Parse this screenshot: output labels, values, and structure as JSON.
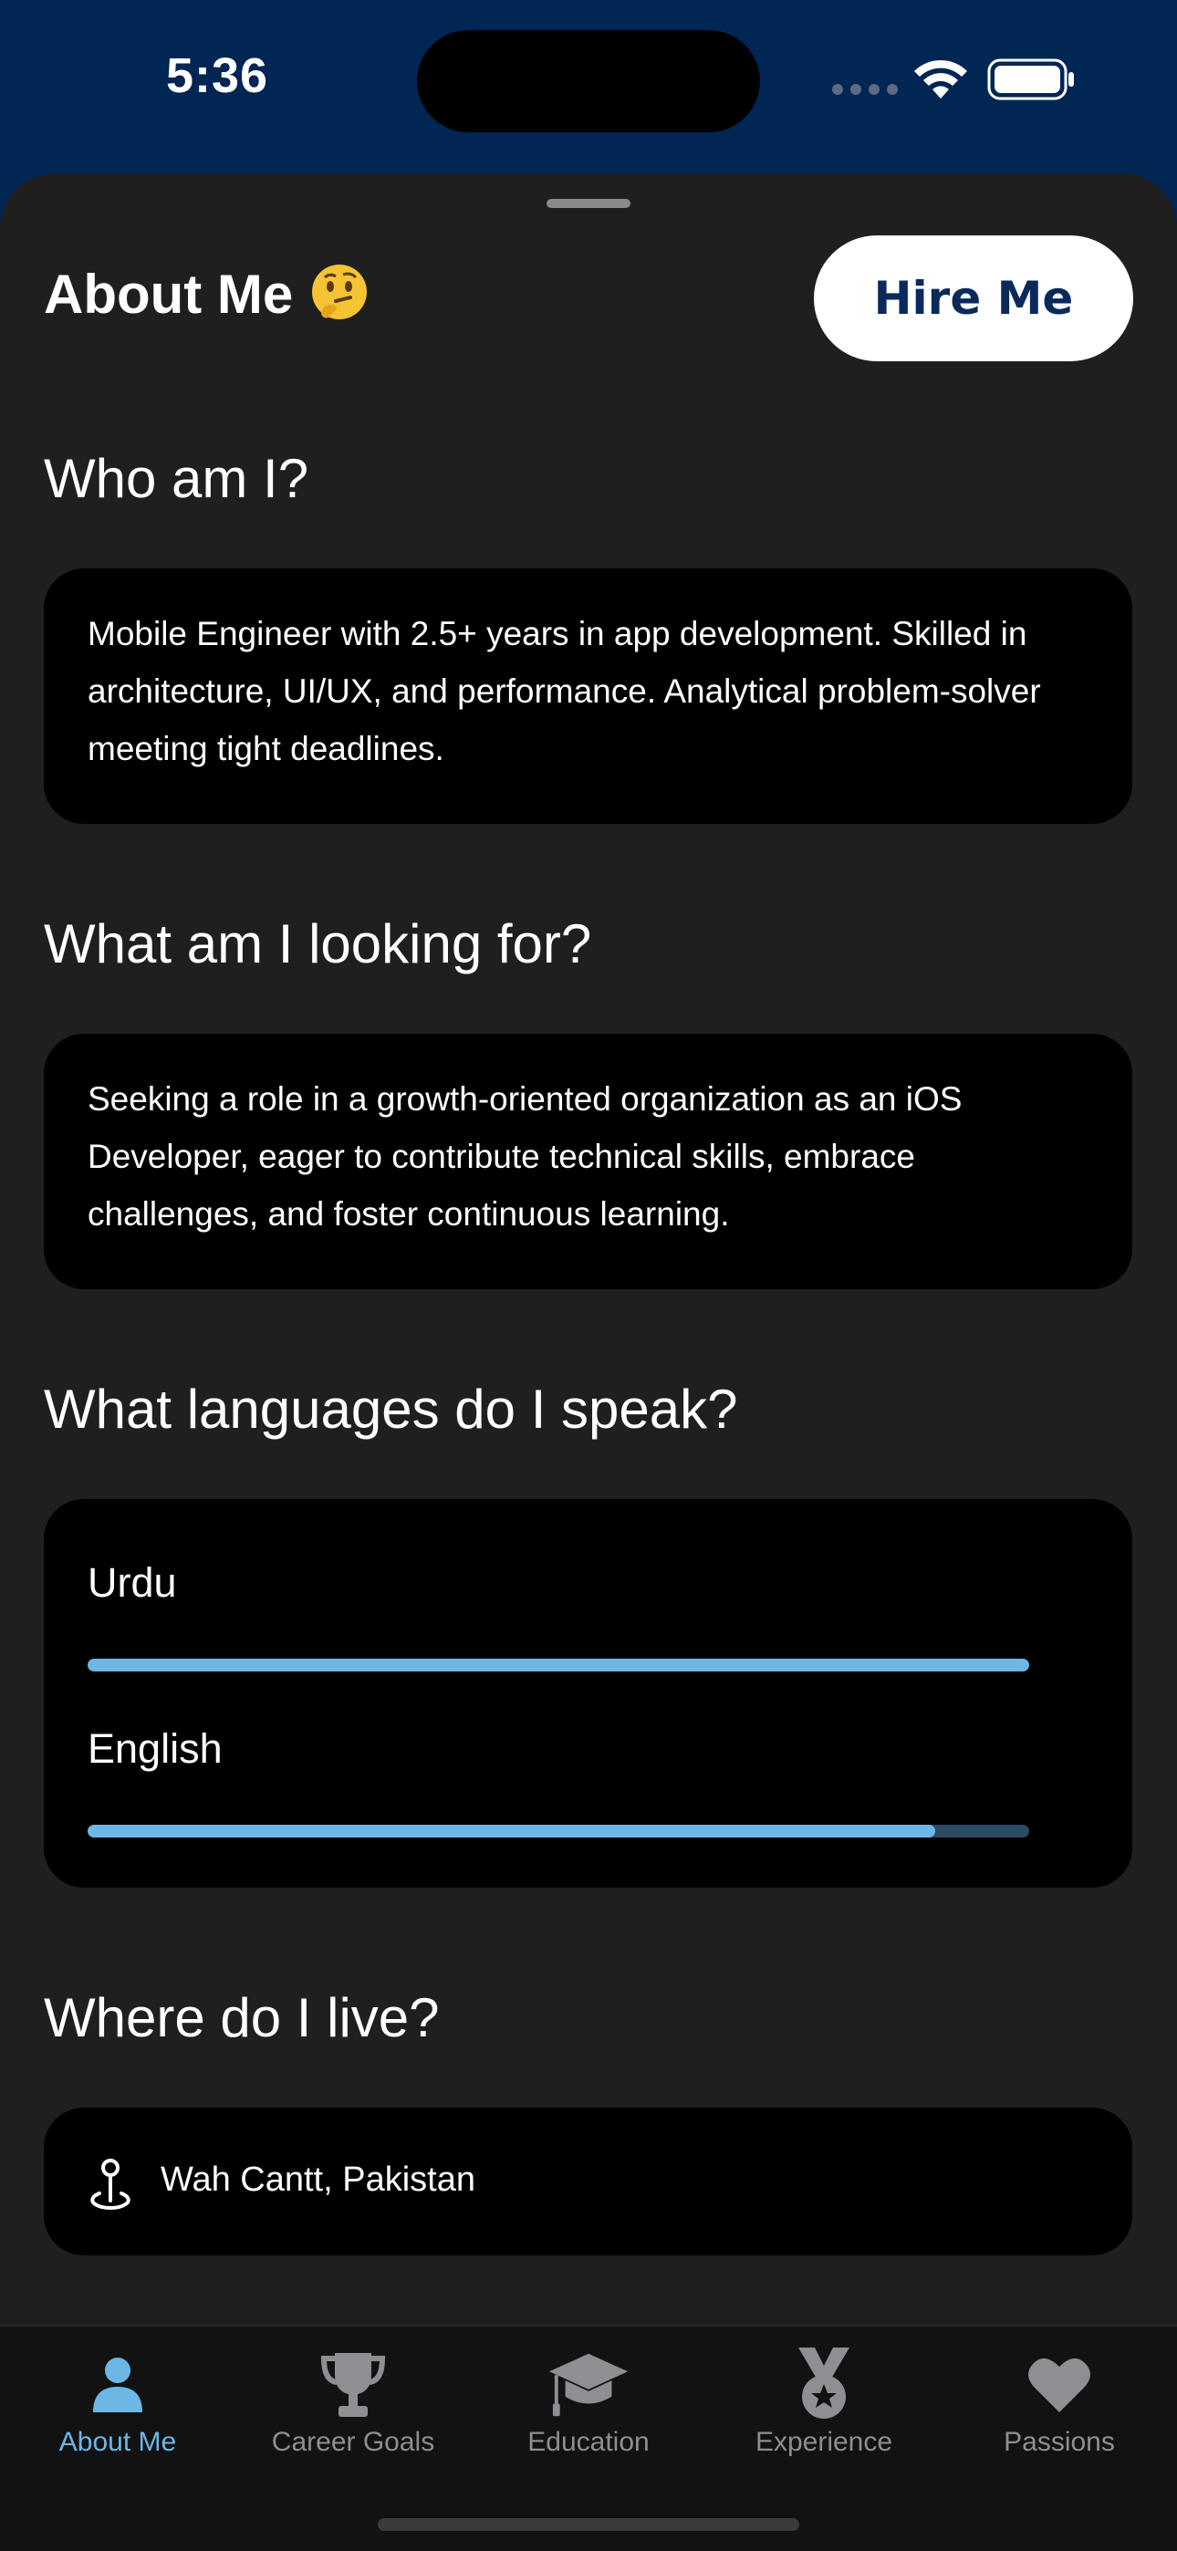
{
  "status_bar": {
    "time": "5:36"
  },
  "header": {
    "title": "About Me",
    "hire_button_label": "Hire Me"
  },
  "sections": {
    "who": {
      "heading": "Who am I?",
      "body": "Mobile Engineer with 2.5+ years in app development. Skilled in architecture, UI/UX, and performance. Analytical problem-solver meeting tight deadlines."
    },
    "looking": {
      "heading": "What am I looking for?",
      "body": "Seeking a role in a growth-oriented organization as an iOS Developer, eager to contribute technical skills, embrace challenges, and foster continuous learning."
    },
    "languages": {
      "heading": "What languages do I speak?",
      "items": [
        {
          "name": "Urdu",
          "proficiency": 1.0
        },
        {
          "name": "English",
          "proficiency": 0.9
        }
      ]
    },
    "location": {
      "heading": "Where do I live?",
      "value": "Wah Cantt, Pakistan"
    }
  },
  "tab_bar": {
    "tabs": [
      {
        "label": "About Me",
        "icon": "person-icon",
        "active": true
      },
      {
        "label": "Career Goals",
        "icon": "trophy-icon",
        "active": false
      },
      {
        "label": "Education",
        "icon": "graduation-cap-icon",
        "active": false
      },
      {
        "label": "Experience",
        "icon": "medal-icon",
        "active": false
      },
      {
        "label": "Passions",
        "icon": "heart-icon",
        "active": false
      }
    ]
  },
  "colors": {
    "accent": "#6cb7e6",
    "status_bar_bg": "#002654",
    "sheet_bg": "#1f1f20",
    "card_bg": "#000000",
    "inactive_tab": "#8e8e93",
    "hire_text": "#0a2a5c"
  }
}
